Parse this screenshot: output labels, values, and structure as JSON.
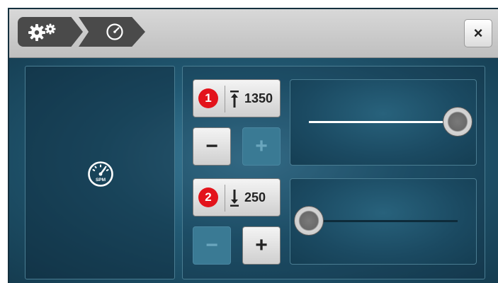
{
  "titlebar": {
    "breadcrumbs": [
      {
        "icon": "settings-gears-icon"
      },
      {
        "icon": "speedometer-icon"
      }
    ],
    "close_label": "×"
  },
  "left_panel": {
    "icon": "speedometer-icon",
    "icon_label": "SPM"
  },
  "controls": [
    {
      "badge": "1",
      "arrow_icon": "arrow-up-to-bar-icon",
      "value": "1350",
      "minus_label": "−",
      "plus_label": "+",
      "minus_enabled": true,
      "plus_enabled": false,
      "slider_fraction": 1.0
    },
    {
      "badge": "2",
      "arrow_icon": "arrow-down-to-bar-icon",
      "value": "250",
      "minus_label": "−",
      "plus_label": "+",
      "minus_enabled": false,
      "plus_enabled": true,
      "slider_fraction": 0.0
    }
  ],
  "colors": {
    "background": "#1d4257",
    "badge": "#e3131b",
    "slider_fill": "#ffffff",
    "disabled_button": "#3a7a94"
  }
}
